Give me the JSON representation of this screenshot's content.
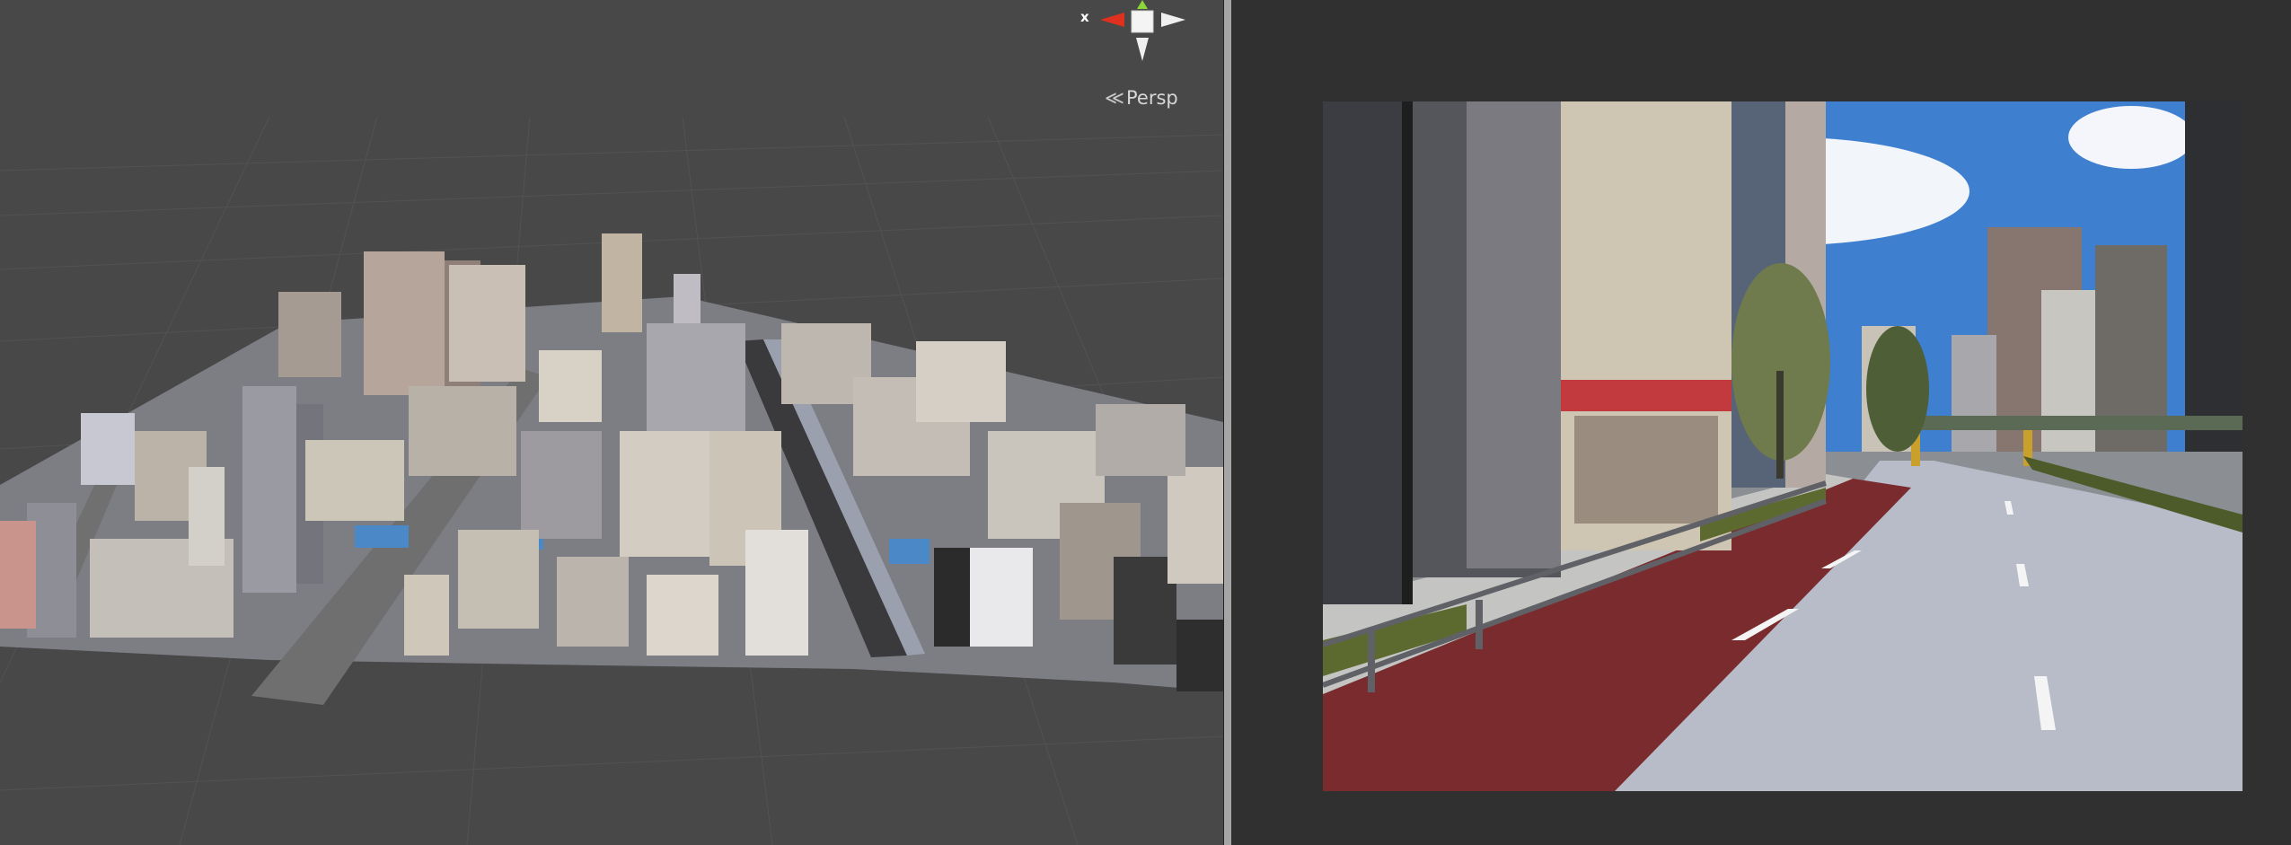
{
  "scene_view": {
    "projection_label": "Persp",
    "gizmo": {
      "x_axis_label": "x",
      "x_axis_color": "#e0301e",
      "y_axis_color": "#8cd63a",
      "z_axis_color": "#f0f0f0",
      "icon": "orientation-gizmo-icon"
    },
    "background_color": "#484848"
  },
  "game_view": {
    "background_color": "#303030",
    "sky_color": "#3f7fd0",
    "bike_lane_color": "#7a2b2e",
    "road_color": "#b8bcc8"
  }
}
